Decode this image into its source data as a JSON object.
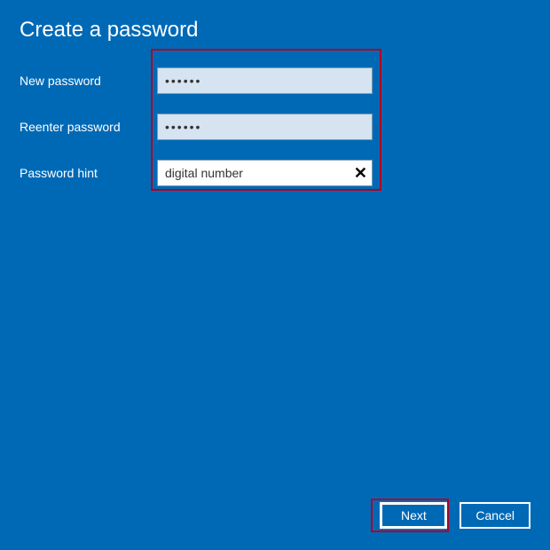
{
  "title": "Create a password",
  "labels": {
    "new_password": "New password",
    "reenter_password": "Reenter password",
    "password_hint": "Password hint"
  },
  "values": {
    "new_password": "••••••",
    "reenter_password": "••••••",
    "password_hint": "digital number"
  },
  "buttons": {
    "next": "Next",
    "cancel": "Cancel"
  },
  "icons": {
    "clear": "✕"
  }
}
